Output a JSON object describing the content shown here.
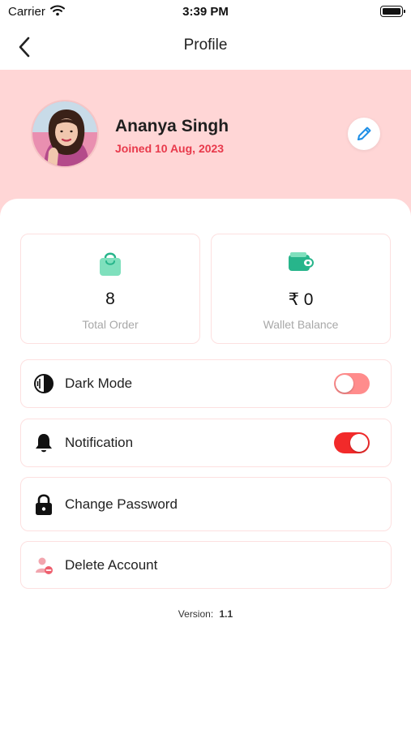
{
  "status_bar": {
    "carrier": "Carrier",
    "time": "3:39 PM"
  },
  "nav": {
    "title": "Profile"
  },
  "profile": {
    "name": "Ananya Singh",
    "joined": "Joined 10 Aug, 2023"
  },
  "stats": {
    "orders": {
      "value": "8",
      "label": "Total Order"
    },
    "wallet": {
      "value": "₹ 0",
      "label": "Wallet Balance"
    }
  },
  "settings": {
    "dark_mode": {
      "label": "Dark Mode",
      "enabled": false
    },
    "notification": {
      "label": "Notification",
      "enabled": true
    },
    "change_password": {
      "label": "Change Password"
    },
    "delete_account": {
      "label": "Delete Account"
    }
  },
  "footer": {
    "version_label": "Version:",
    "version_value": "1.1"
  },
  "colors": {
    "header_bg": "#ffd6d6",
    "accent_red": "#e8394b",
    "toggle_on": "#f22a2a",
    "toggle_off": "#ff8c8c",
    "bag_icon": "#5fd2a6",
    "wallet_icon": "#27b58b",
    "edit_icon": "#1f8fe6"
  },
  "icons": {
    "back": "chevron-left-icon",
    "edit": "pencil-icon",
    "orders": "shopping-bag-icon",
    "wallet": "wallet-icon",
    "dark_mode": "contrast-icon",
    "notification": "bell-icon",
    "change_password": "lock-icon",
    "delete_account": "user-remove-icon"
  }
}
